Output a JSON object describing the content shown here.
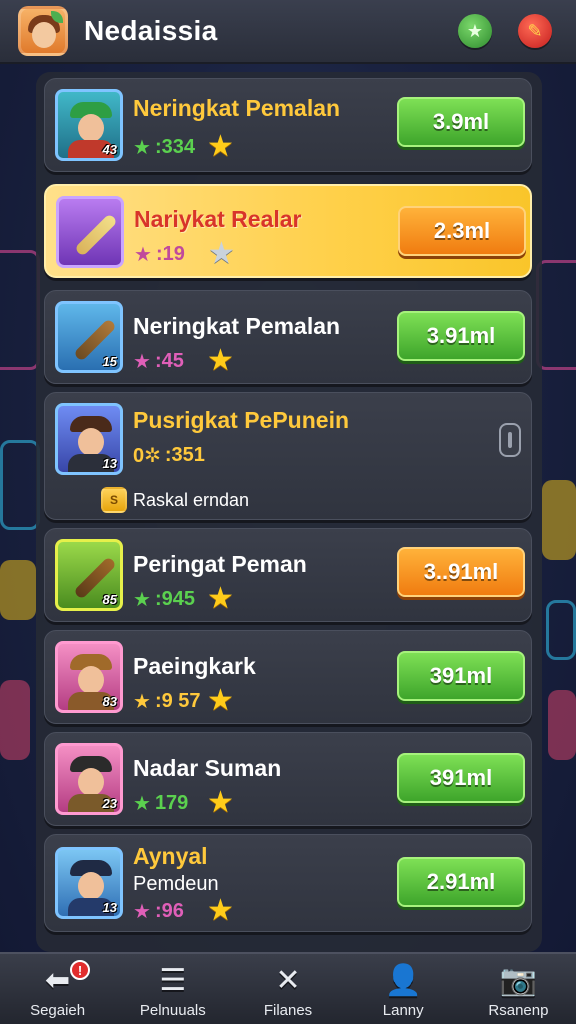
{
  "header": {
    "title": "Nedaissia",
    "logo_icon": "player-avatar-icon",
    "right_buttons": [
      {
        "icon": "star-icon",
        "glyph": "★"
      },
      {
        "icon": "edit-pencil-icon",
        "glyph": "✎"
      }
    ]
  },
  "players": [
    {
      "name": "Neringkat Pemalan",
      "level": "43",
      "stat_icon": "★",
      "stat": ":334",
      "price": "3.9ml"
    },
    {
      "name": "Nariykat Realar",
      "level": "",
      "stat_icon": "★",
      "stat": ":19",
      "price": "2.3ml"
    },
    {
      "name": "Neringkat Pemalan",
      "level": "15",
      "stat_icon": "★",
      "stat": ":45",
      "price": "3.91ml"
    },
    {
      "name": "Pusrigkat PePunein",
      "level": "13",
      "stat_icon": "0✲",
      "stat": ":351",
      "tag": "Raskal erndan",
      "tag_icon": "S"
    },
    {
      "name": "Peringat Peman",
      "level": "85",
      "stat_icon": "★",
      "stat": ":945",
      "price": "3..91ml"
    },
    {
      "name": "Paeingkark",
      "level": "83",
      "stat_icon": "★",
      "stat": ":9 57",
      "price": "391ml"
    },
    {
      "name": "Nadar Suman",
      "level": "23",
      "stat_icon": "★",
      "stat": "179",
      "price": "391ml"
    },
    {
      "name": "Aynyal",
      "sub_name": "Pemdeun",
      "level": "13",
      "stat_icon": "★",
      "stat": ":96",
      "price": "2.91ml"
    }
  ],
  "bottom_nav": [
    {
      "label": "Segaieh",
      "icon": "back-arrow-icon",
      "glyph": "⬅",
      "badge": "!"
    },
    {
      "label": "Pelnuuals",
      "icon": "list-icon",
      "glyph": "☰"
    },
    {
      "label": "Filanes",
      "icon": "crossed-swords-icon",
      "glyph": "✕"
    },
    {
      "label": "Lanny",
      "icon": "person-icon",
      "glyph": "👤"
    },
    {
      "label": "Rsanenp",
      "icon": "camera-icon",
      "glyph": "📷"
    }
  ],
  "colors": {
    "accent_green": "#3ea52b",
    "accent_orange": "#f07c10",
    "highlight_gold": "#ffd049",
    "star_gold": "#ffcc1a"
  }
}
